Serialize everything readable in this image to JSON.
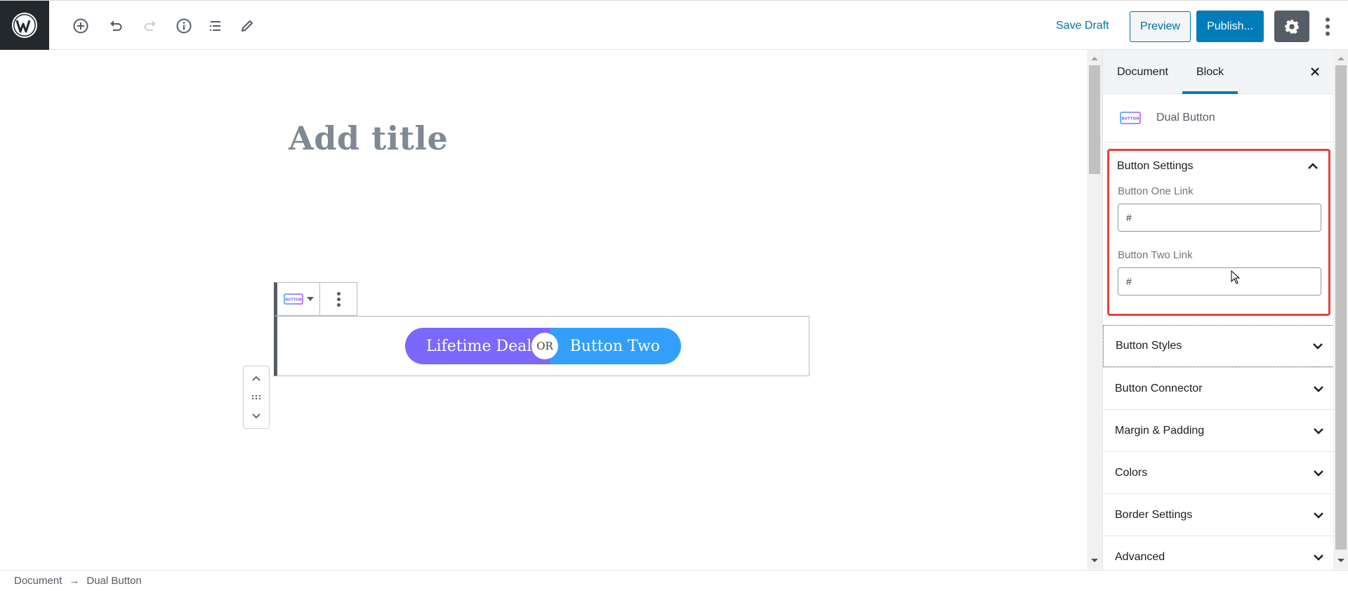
{
  "header": {
    "logo": "wordpress-logo",
    "tools": [
      {
        "name": "add-block",
        "icon": "plus-circle-icon"
      },
      {
        "name": "undo",
        "icon": "undo-icon"
      },
      {
        "name": "redo",
        "icon": "redo-icon",
        "disabled": true
      },
      {
        "name": "content-structure",
        "icon": "info-icon"
      },
      {
        "name": "block-navigation",
        "icon": "list-icon"
      },
      {
        "name": "tools",
        "icon": "pencil-icon"
      }
    ],
    "save_draft_label": "Save Draft",
    "preview_label": "Preview",
    "publish_label": "Publish...",
    "settings_icon": "gear-icon",
    "more_icon": "vertical-ellipsis-icon"
  },
  "editor": {
    "title_placeholder": "Add title",
    "block": {
      "switcher_icon_text": "BUTTON",
      "button_one_label": "Lifetime Deal",
      "connector_label": "OR",
      "button_two_label": "Button Two",
      "colors": {
        "button_one": "#7b68fd",
        "button_two": "#339ffd"
      }
    }
  },
  "sidebar": {
    "tabs": [
      {
        "label": "Document",
        "active": false
      },
      {
        "label": "Block",
        "active": true
      }
    ],
    "block_card": {
      "name": "Dual Button",
      "icon_text": "BUTTON"
    },
    "open_panel": {
      "title": "Button Settings",
      "fields": [
        {
          "label": "Button One Link",
          "value": "#"
        },
        {
          "label": "Button Two Link",
          "value": "#"
        }
      ]
    },
    "panels": [
      {
        "title": "Button Styles"
      },
      {
        "title": "Button Connector"
      },
      {
        "title": "Margin & Padding"
      },
      {
        "title": "Colors"
      },
      {
        "title": "Border Settings"
      },
      {
        "title": "Advanced"
      }
    ]
  },
  "footer": {
    "breadcrumb": [
      "Document",
      "Dual Button"
    ],
    "separator": "→"
  },
  "colors": {
    "accent": "#007cba",
    "highlight_border": "#e8403a",
    "header_logo_bg": "#23282d"
  }
}
